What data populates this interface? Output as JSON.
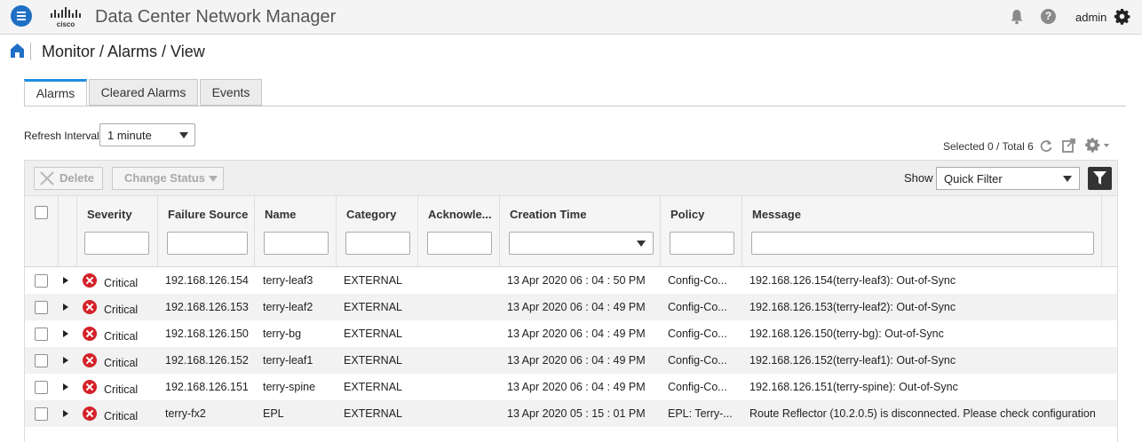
{
  "app": {
    "title": "Data Center Network Manager",
    "logo_text": "cisco",
    "user": "admin",
    "icons": [
      "menu-icon",
      "bell-icon",
      "help-icon",
      "gear-icon"
    ]
  },
  "breadcrumb": "Monitor / Alarms / View",
  "tabs": [
    {
      "label": "Alarms",
      "active": true
    },
    {
      "label": "Cleared Alarms",
      "active": false
    },
    {
      "label": "Events",
      "active": false
    }
  ],
  "refresh": {
    "label": "Refresh Interval",
    "value": "1 minute"
  },
  "selection": {
    "text": "Selected 0 / Total 6"
  },
  "toolbar": {
    "delete_label": "Delete",
    "change_status_label": "Change Status",
    "show_label": "Show",
    "filter_value": "Quick Filter"
  },
  "columns": [
    "Severity",
    "Failure Source",
    "Name",
    "Category",
    "Acknowle...",
    "Creation Time",
    "Policy",
    "Message"
  ],
  "rows": [
    {
      "severity": "Critical",
      "source": "192.168.126.154",
      "name": "terry-leaf3",
      "category": "EXTERNAL",
      "ack": "",
      "time": "13 Apr 2020 06 : 04 : 50 PM",
      "policy": "Config-Co...",
      "message": "192.168.126.154(terry-leaf3): Out-of-Sync"
    },
    {
      "severity": "Critical",
      "source": "192.168.126.153",
      "name": "terry-leaf2",
      "category": "EXTERNAL",
      "ack": "",
      "time": "13 Apr 2020 06 : 04 : 49 PM",
      "policy": "Config-Co...",
      "message": "192.168.126.153(terry-leaf2): Out-of-Sync"
    },
    {
      "severity": "Critical",
      "source": "192.168.126.150",
      "name": "terry-bg",
      "category": "EXTERNAL",
      "ack": "",
      "time": "13 Apr 2020 06 : 04 : 49 PM",
      "policy": "Config-Co...",
      "message": "192.168.126.150(terry-bg): Out-of-Sync"
    },
    {
      "severity": "Critical",
      "source": "192.168.126.152",
      "name": "terry-leaf1",
      "category": "EXTERNAL",
      "ack": "",
      "time": "13 Apr 2020 06 : 04 : 49 PM",
      "policy": "Config-Co...",
      "message": "192.168.126.152(terry-leaf1): Out-of-Sync"
    },
    {
      "severity": "Critical",
      "source": "192.168.126.151",
      "name": "terry-spine",
      "category": "EXTERNAL",
      "ack": "",
      "time": "13 Apr 2020 06 : 04 : 49 PM",
      "policy": "Config-Co...",
      "message": "192.168.126.151(terry-spine): Out-of-Sync"
    },
    {
      "severity": "Critical",
      "source": "terry-fx2",
      "name": "EPL",
      "category": "EXTERNAL",
      "ack": "",
      "time": "13 Apr 2020 05 : 15 : 01 PM",
      "policy": "EPL: Terry-...",
      "message": "Route Reflector (10.2.0.5) is disconnected. Please check configuration. ..."
    }
  ],
  "colors": {
    "accent": "#1f8de0",
    "critical": "#d3222a",
    "brand": "#1f6fc5"
  }
}
